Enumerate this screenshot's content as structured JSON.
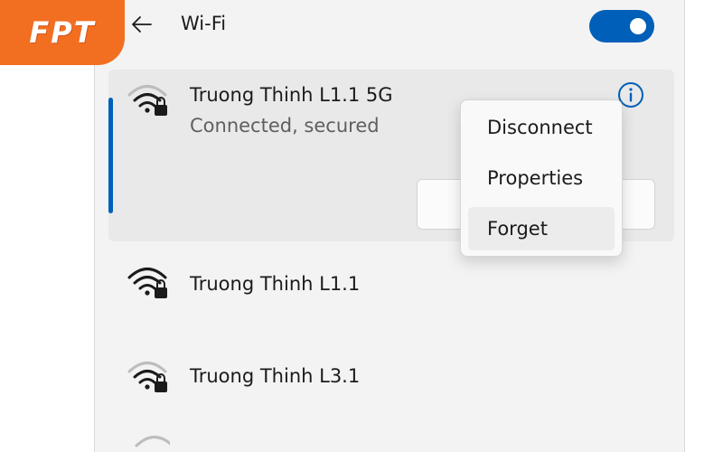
{
  "brand": {
    "logo_text": "FPT",
    "color": "#f26f21"
  },
  "header": {
    "title": "Wi-Fi",
    "back_icon": "arrow-left-icon",
    "toggle": {
      "state": "on",
      "color": "#005fb8"
    }
  },
  "connected_network": {
    "name": "Truong Thinh L1.1 5G",
    "status": "Connected, secured",
    "signal_icon": "wifi-secured-icon",
    "info_icon": "info-icon"
  },
  "context_menu": {
    "items": [
      {
        "label": "Disconnect"
      },
      {
        "label": "Properties"
      },
      {
        "label": "Forget"
      }
    ],
    "highlighted": "Forget"
  },
  "networks": [
    {
      "name": "Truong Thinh L1.1",
      "signal_icon": "wifi-secured-icon"
    },
    {
      "name": "Truong Thinh L3.1",
      "signal_icon": "wifi-secured-icon"
    }
  ],
  "colors": {
    "accent": "#005fb8",
    "panel": "#f3f3f3",
    "selected_card": "#e9e9e9"
  }
}
